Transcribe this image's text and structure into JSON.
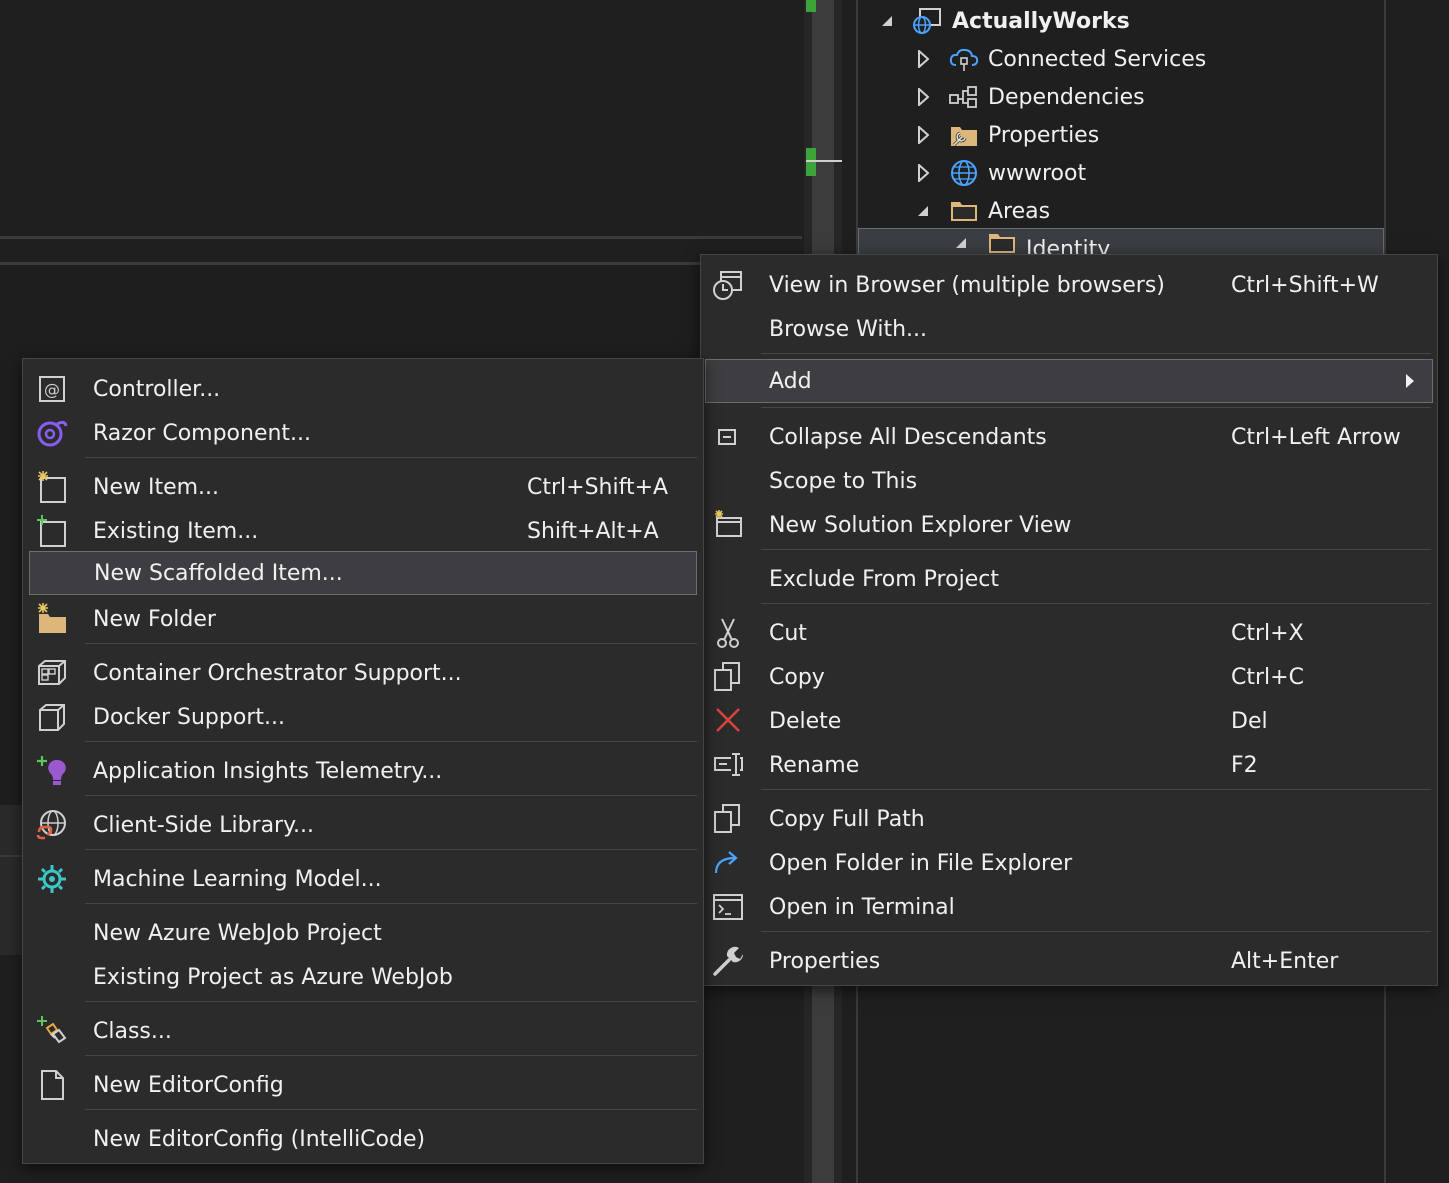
{
  "solution_explorer": {
    "project": "ActuallyWorks",
    "items": [
      {
        "label": "Connected Services",
        "icon": "connected-services-icon",
        "expanded": false
      },
      {
        "label": "Dependencies",
        "icon": "dependencies-icon",
        "expanded": false
      },
      {
        "label": "Properties",
        "icon": "properties-folder-icon",
        "expanded": false
      },
      {
        "label": "wwwroot",
        "icon": "globe-icon",
        "expanded": false
      },
      {
        "label": "Areas",
        "icon": "folder-icon",
        "expanded": true
      }
    ],
    "selected_item": "Identity"
  },
  "context_menu": {
    "items": [
      {
        "label": "View in Browser (multiple browsers)",
        "shortcut": "Ctrl+Shift+W",
        "icon": "view-in-browser-icon"
      },
      {
        "label": "Browse With...",
        "shortcut": ""
      },
      {
        "label": "Add",
        "shortcut": "",
        "submenu": true,
        "highlighted": true
      },
      {
        "label": "Collapse All Descendants",
        "shortcut": "Ctrl+Left Arrow",
        "icon": "collapse-icon"
      },
      {
        "label": "Scope to This",
        "shortcut": ""
      },
      {
        "label": "New Solution Explorer View",
        "shortcut": "",
        "icon": "new-view-icon"
      },
      {
        "label": "Exclude From Project",
        "shortcut": ""
      },
      {
        "label": "Cut",
        "shortcut": "Ctrl+X",
        "icon": "scissors-icon"
      },
      {
        "label": "Copy",
        "shortcut": "Ctrl+C",
        "icon": "copy-icon"
      },
      {
        "label": "Delete",
        "shortcut": "Del",
        "icon": "delete-icon"
      },
      {
        "label": "Rename",
        "shortcut": "F2",
        "icon": "rename-icon"
      },
      {
        "label": "Copy Full Path",
        "shortcut": "",
        "icon": "copy-path-icon"
      },
      {
        "label": "Open Folder in File Explorer",
        "shortcut": "",
        "icon": "open-folder-icon"
      },
      {
        "label": "Open in Terminal",
        "shortcut": "",
        "icon": "terminal-icon"
      },
      {
        "label": "Properties",
        "shortcut": "Alt+Enter",
        "icon": "wrench-icon"
      }
    ]
  },
  "add_submenu": {
    "items": [
      {
        "label": "Controller...",
        "shortcut": "",
        "icon": "controller-icon"
      },
      {
        "label": "Razor Component...",
        "shortcut": "",
        "icon": "razor-icon"
      },
      {
        "label": "New Item...",
        "shortcut": "Ctrl+Shift+A",
        "icon": "new-item-icon"
      },
      {
        "label": "Existing Item...",
        "shortcut": "Shift+Alt+A",
        "icon": "existing-item-icon"
      },
      {
        "label": "New Scaffolded Item...",
        "shortcut": "",
        "highlighted": true
      },
      {
        "label": "New Folder",
        "shortcut": "",
        "icon": "new-folder-icon"
      },
      {
        "label": "Container Orchestrator Support...",
        "shortcut": "",
        "icon": "container-icon"
      },
      {
        "label": "Docker Support...",
        "shortcut": "",
        "icon": "docker-icon"
      },
      {
        "label": "Application Insights Telemetry...",
        "shortcut": "",
        "icon": "app-insights-icon"
      },
      {
        "label": "Client-Side Library...",
        "shortcut": "",
        "icon": "client-library-icon"
      },
      {
        "label": "Machine Learning Model...",
        "shortcut": "",
        "icon": "ml-model-icon"
      },
      {
        "label": "New Azure WebJob Project",
        "shortcut": ""
      },
      {
        "label": "Existing Project as Azure WebJob",
        "shortcut": ""
      },
      {
        "label": "Class...",
        "shortcut": "",
        "icon": "class-icon"
      },
      {
        "label": "New EditorConfig",
        "shortcut": "",
        "icon": "file-icon"
      },
      {
        "label": "New EditorConfig (IntelliCode)",
        "shortcut": ""
      }
    ]
  },
  "colors": {
    "background": "#1f1f1f",
    "menu_bg": "#2b2b2b",
    "highlight": "#3e3e42",
    "accent_green": "#3ba53b",
    "delete_red": "#e0433a",
    "folder_yellow": "#dcb67a"
  }
}
